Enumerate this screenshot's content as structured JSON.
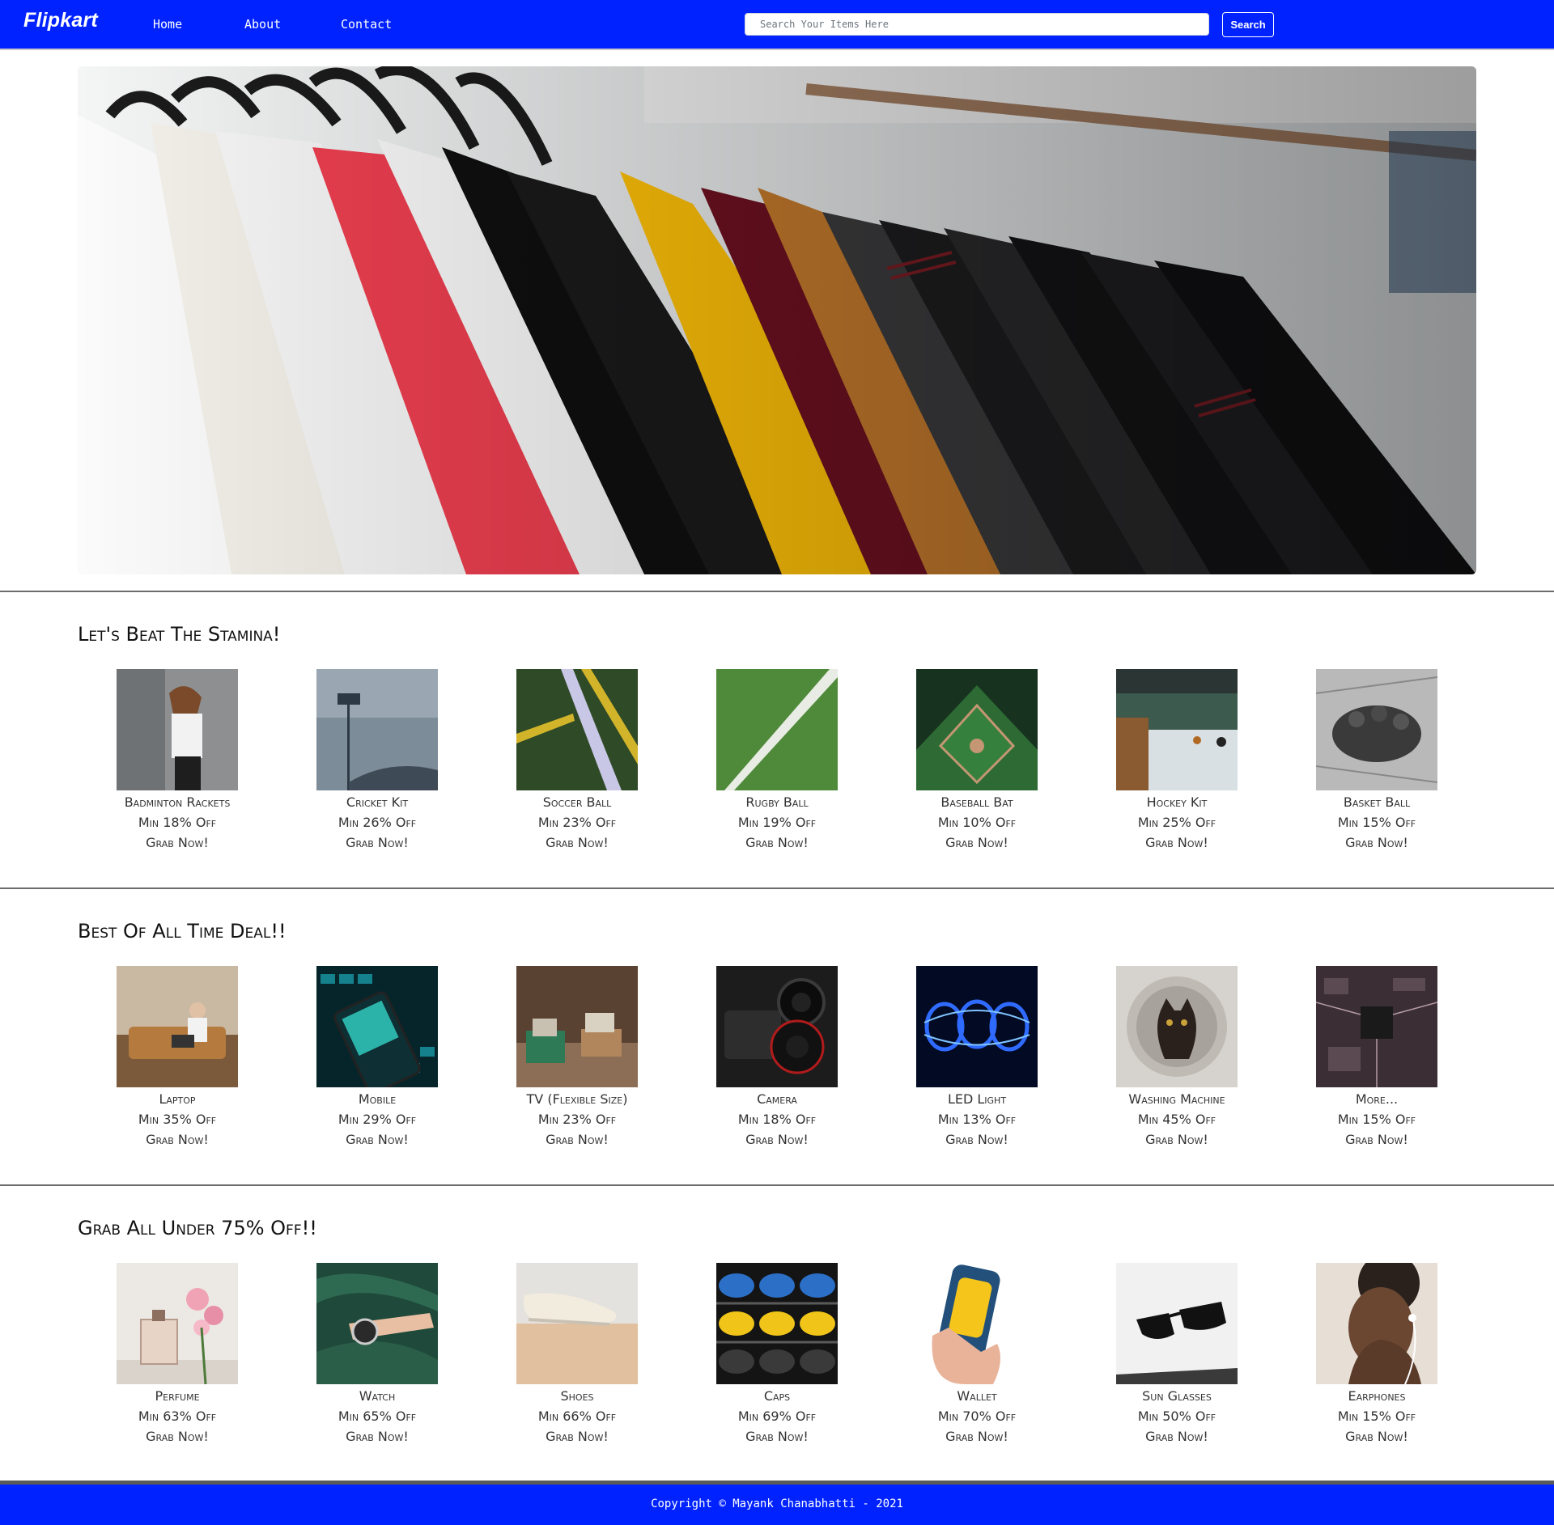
{
  "navbar": {
    "brand": "Flipkart",
    "links": [
      "Home",
      "About",
      "Contact"
    ],
    "search_placeholder": "Search Your Items Here",
    "search_button": "Search",
    "bg_color": "#0022ff"
  },
  "sections": [
    {
      "title": "Let's Beat The Stamina!",
      "items": [
        {
          "name": "Badminton Rackets",
          "offer": "Min 18% Off",
          "cta": "Grab Now!"
        },
        {
          "name": "Cricket Kit",
          "offer": "Min 26% Off",
          "cta": "Grab Now!"
        },
        {
          "name": "Soccer Ball",
          "offer": "Min 23% Off",
          "cta": "Grab Now!"
        },
        {
          "name": "Rugby Ball",
          "offer": "Min 19% Off",
          "cta": "Grab Now!"
        },
        {
          "name": "Baseball Bat",
          "offer": "Min 10% Off",
          "cta": "Grab Now!"
        },
        {
          "name": "Hockey Kit",
          "offer": "Min 25% Off",
          "cta": "Grab Now!"
        },
        {
          "name": "Basket Ball",
          "offer": "Min 15% Off",
          "cta": "Grab Now!"
        }
      ]
    },
    {
      "title": "Best Of All Time Deal!!",
      "items": [
        {
          "name": "Laptop",
          "offer": "Min 35% Off",
          "cta": "Grab Now!"
        },
        {
          "name": "Mobile",
          "offer": "Min 29% Off",
          "cta": "Grab Now!"
        },
        {
          "name": "TV (Flexible Size)",
          "offer": "Min 23% Off",
          "cta": "Grab Now!"
        },
        {
          "name": "Camera",
          "offer": "Min 18% Off",
          "cta": "Grab Now!"
        },
        {
          "name": "LED Light",
          "offer": "Min 13% Off",
          "cta": "Grab Now!"
        },
        {
          "name": "Washing Machine",
          "offer": "Min 45% Off",
          "cta": "Grab Now!"
        },
        {
          "name": "More...",
          "offer": "Min 15% Off",
          "cta": "Grab Now!"
        }
      ]
    },
    {
      "title": "Grab All Under 75% Off!!",
      "items": [
        {
          "name": "Perfume",
          "offer": "Min 63% Off",
          "cta": "Grab Now!"
        },
        {
          "name": "Watch",
          "offer": "Min 65% Off",
          "cta": "Grab Now!"
        },
        {
          "name": "Shoes",
          "offer": "Min 66% Off",
          "cta": "Grab Now!"
        },
        {
          "name": "Caps",
          "offer": "Min 69% Off",
          "cta": "Grab Now!"
        },
        {
          "name": "Wallet",
          "offer": "Min 70% Off",
          "cta": "Grab Now!"
        },
        {
          "name": "Sun Glasses",
          "offer": "Min 50% Off",
          "cta": "Grab Now!"
        },
        {
          "name": "Earphones",
          "offer": "Min 15% Off",
          "cta": "Grab Now!"
        }
      ]
    }
  ],
  "footer": {
    "text": "Copyright © Mayank Chanabhatti - 2021"
  }
}
